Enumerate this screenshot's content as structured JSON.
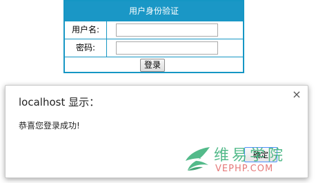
{
  "login_form": {
    "title": "用户身份验证",
    "username_label": "用户名:",
    "username_value": "",
    "password_label": "密码:",
    "password_value": "",
    "login_button": "登录"
  },
  "alert": {
    "title": "localhost 显示：",
    "message": "恭喜您登录成功!",
    "ok_button": "确定",
    "close_glyph": "×"
  },
  "watermark": {
    "chinese": "维易学院",
    "english": "VEPHP.COM"
  },
  "colors": {
    "form_border": "#1596c4",
    "form_header": "#1a97c6",
    "watermark_green": "#41b37e",
    "watermark_red": "#e36a6a"
  }
}
